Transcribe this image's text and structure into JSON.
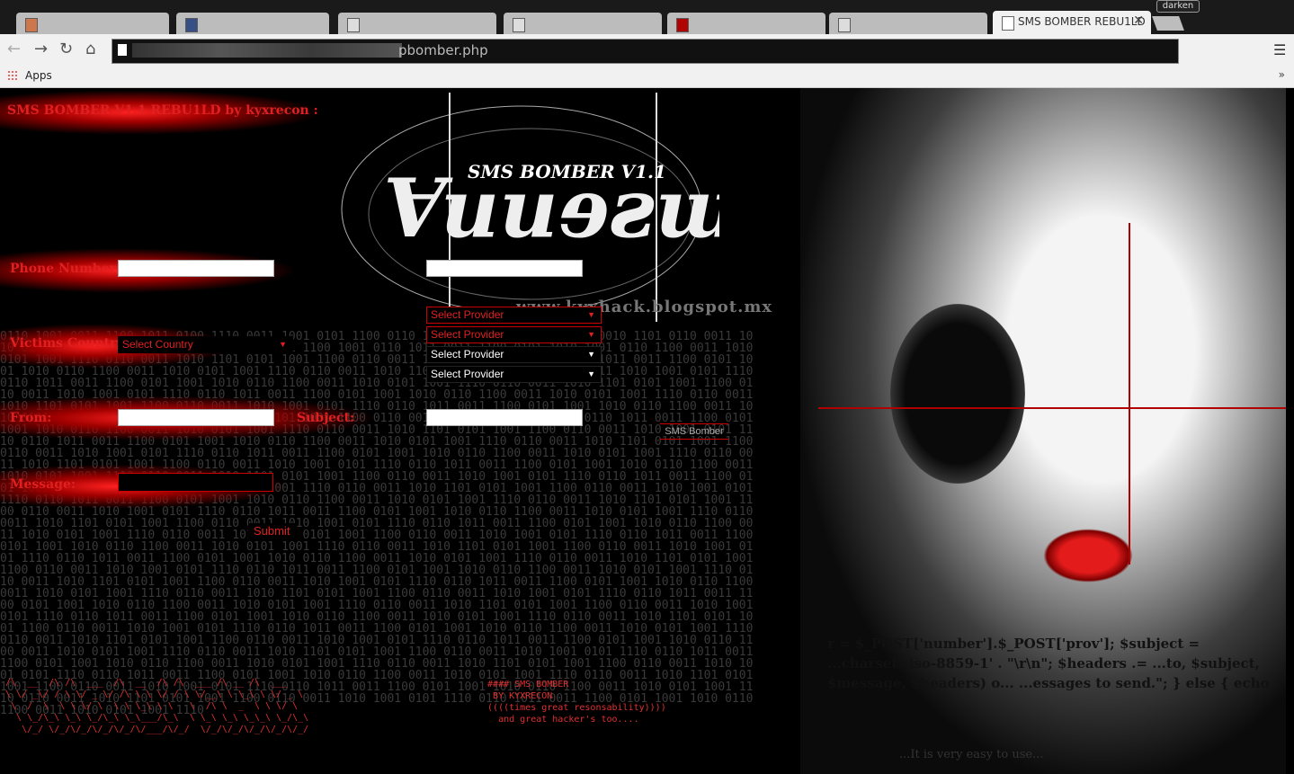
{
  "browser": {
    "tabs": [
      "",
      "",
      "",
      "",
      "",
      ""
    ],
    "active_tab": "SMS BOMBER REBU1LD",
    "extension_badge": "darken",
    "url_visible": "pbomber.php",
    "bookmarks": {
      "apps": "Apps"
    }
  },
  "page": {
    "title": "SMS BOMBER V1.1 REBU1LD by kyxrecon :",
    "logo_subtitle": "SMS BOMBER V1.1",
    "blog": "www.kyxhack.blogspot.mx",
    "form": {
      "phone_label": "Phone Number:",
      "country_label": "Victims Country:",
      "country_select": "Select Country",
      "provider_selects": [
        "Select Provider",
        "Select Provider",
        "Select Provider",
        "Select Provider"
      ],
      "from_label": "From:",
      "subject_label": "Subject:",
      "message_label": "Message:",
      "submit": "Submit",
      "sms_bomber_button": "SMS Bomber"
    },
    "credits": "  #### SMS BOMBER\n   BY KYXRECON\n  ((((times great resonsability))))\n    and great hacker's too....",
    "code_snippet": "r = $_POST['number'].$_POST['prov']; $subject = ...charset=iso-8859-1' . \"\\r\\n\"; $headers .= ...to, $subject, $message, $headers) o... ...essages to send.\"; } else { echo",
    "easy_note": "...It is very easy to use..."
  }
}
